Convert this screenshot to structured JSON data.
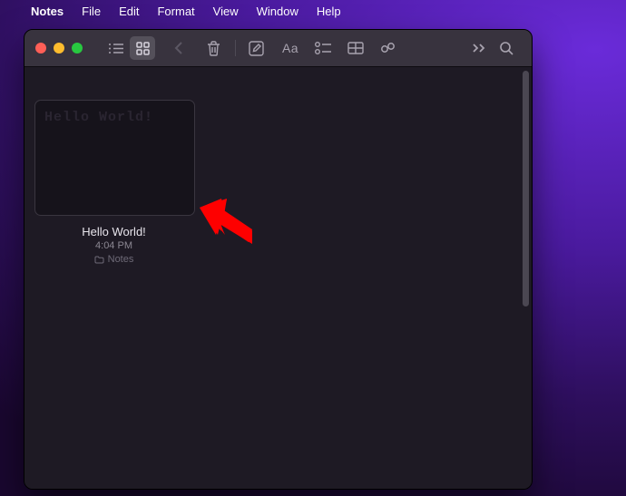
{
  "menubar": {
    "app": "Notes",
    "items": [
      "File",
      "Edit",
      "Format",
      "View",
      "Window",
      "Help"
    ]
  },
  "toolbar": {
    "icons": {
      "list_view": "list-view-icon",
      "grid_view": "grid-view-icon",
      "back": "chevron-left-icon",
      "trash": "trash-icon",
      "new_note": "new-note-icon",
      "text_style": "text-style-icon",
      "checklist": "checklist-icon",
      "table": "table-icon",
      "link": "link-icon",
      "more": "chevron-double-right-icon",
      "search": "search-icon"
    },
    "text_style_label": "Aa"
  },
  "notes": [
    {
      "preview_text": "Hello World!",
      "title": "Hello World!",
      "time": "4:04 PM",
      "folder": "Notes"
    }
  ]
}
